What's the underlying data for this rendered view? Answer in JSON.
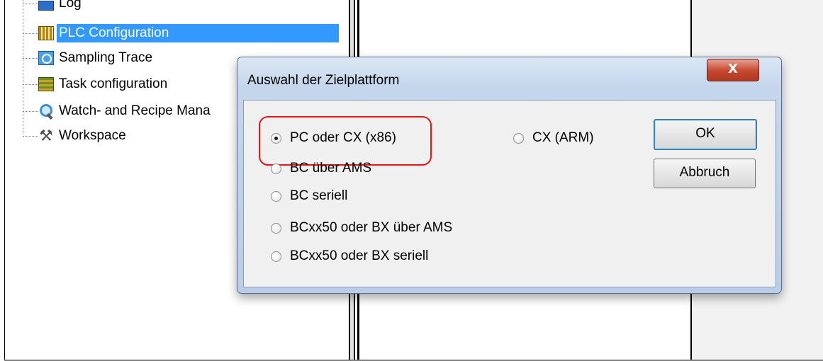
{
  "tree": {
    "items": [
      {
        "label": "Log",
        "icon": "log-icon"
      },
      {
        "label": "PLC Configuration",
        "icon": "plc-configuration-icon",
        "selected": true
      },
      {
        "label": "Sampling Trace",
        "icon": "sampling-trace-icon"
      },
      {
        "label": "Task configuration",
        "icon": "task-configuration-icon"
      },
      {
        "label": "Watch- and Recipe Mana",
        "icon": "watch-recipe-icon"
      },
      {
        "label": "Workspace",
        "icon": "workspace-icon"
      }
    ]
  },
  "dialog": {
    "title": "Auswahl der Zielplattform",
    "close_label": "X",
    "options": [
      {
        "label": "PC oder CX (x86)",
        "selected": true
      },
      {
        "label": "CX (ARM)",
        "selected": false
      },
      {
        "label": "BC über AMS",
        "selected": false
      },
      {
        "label": "BC seriell",
        "selected": false
      },
      {
        "label": "BCxx50 oder BX über AMS",
        "selected": false
      },
      {
        "label": "BCxx50 oder BX seriell",
        "selected": false
      }
    ],
    "ok_label": "OK",
    "cancel_label": "Abbruch"
  },
  "colors": {
    "selection": "#3399ff",
    "highlight_ring": "#e21818",
    "close_button": "#c4462e"
  }
}
